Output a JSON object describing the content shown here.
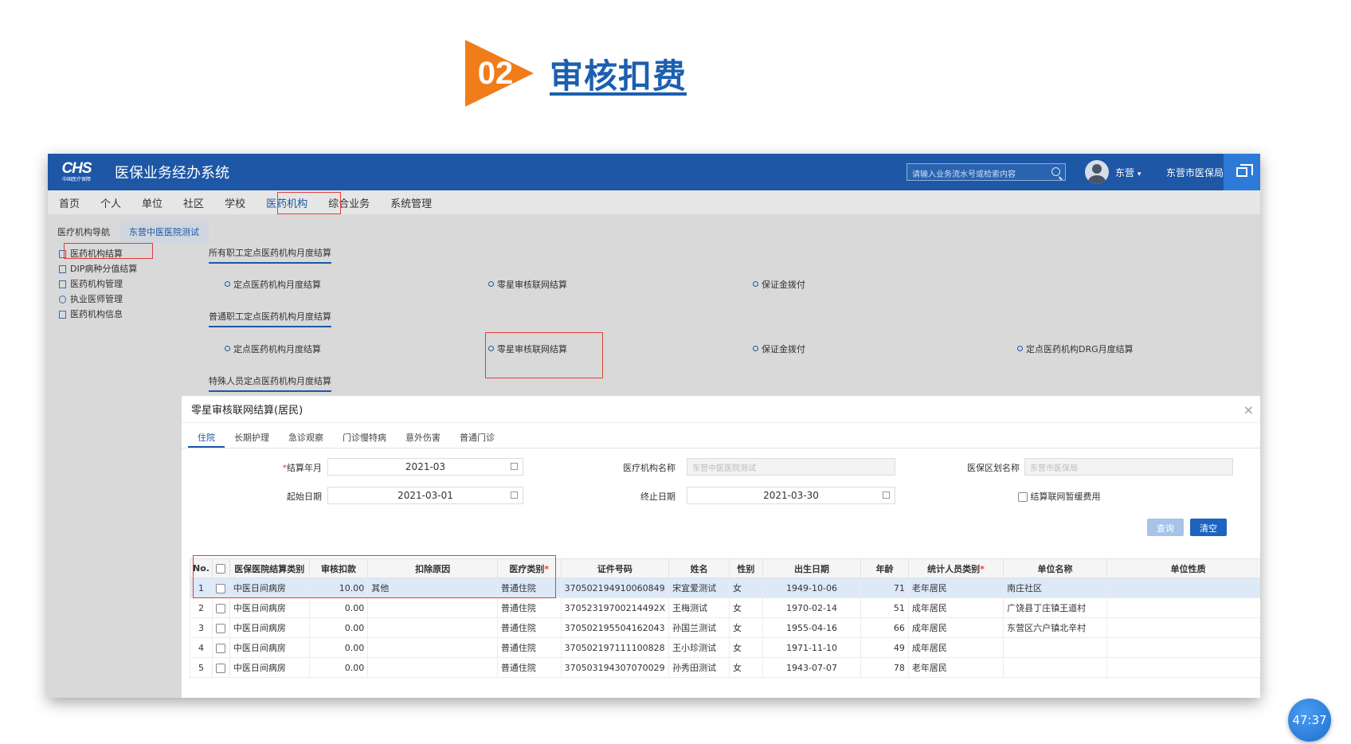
{
  "slide": {
    "badge_number": "02",
    "title": "审核扣费",
    "accent_color": "#f07d1a",
    "title_color": "#1c5fb0"
  },
  "app": {
    "logo_main": "CHS",
    "logo_sub": "中国医疗保障",
    "title": "医保业务经办系统",
    "search_placeholder": "请输入业务流水号或检索内容",
    "user_name": "东营",
    "user_caret": "▾",
    "org_name": "东营市医保局"
  },
  "nav": [
    "首页",
    "个人",
    "单位",
    "社区",
    "学校",
    "医药机构",
    "综合业务",
    "系统管理"
  ],
  "secondary_tabs": [
    "医疗机构导航",
    "东营中医医院测试"
  ],
  "tree": [
    "医药机构结算",
    "DIP病种分值结算",
    "医药机构管理",
    "执业医师管理",
    "医药机构信息"
  ],
  "sections": {
    "s1_title": "所有职工定点医药机构月度结算",
    "s1_links": [
      "定点医药机构月度结算",
      "零星审核联网结算",
      "保证金拨付"
    ],
    "s2_title": "普通职工定点医药机构月度结算",
    "s2_links": [
      "定点医药机构月度结算",
      "零星审核联网结算",
      "保证金拨付",
      "定点医药机构DRG月度结算"
    ],
    "s3_title": "特殊人员定点医药机构月度结算"
  },
  "dialog": {
    "title": "零星审核联网结算(居民)",
    "close": "×",
    "tabs": [
      "住院",
      "长期护理",
      "急诊观察",
      "门诊慢特病",
      "意外伤害",
      "普通门诊"
    ],
    "form": {
      "settle_month_label": "结算年月",
      "settle_month_required": "*",
      "settle_month": "2021-03",
      "start_date_label": "起始日期",
      "start_date": "2021-03-01",
      "org_name_label": "医疗机构名称",
      "org_name": "东营中医医院测试",
      "end_date_label": "终止日期",
      "end_date": "2021-03-30",
      "region_label": "医保区划名称",
      "region": "东营市医保局",
      "checkbox_label": "结算联网暂缓费用"
    },
    "buttons": {
      "query": "查询",
      "clear": "清空"
    },
    "table": {
      "headers": [
        "No.",
        "",
        "医保医院结算类别",
        "审核扣款",
        "扣除原因",
        "医疗类别",
        "证件号码",
        "姓名",
        "性别",
        "出生日期",
        "年龄",
        "统计人员类别",
        "单位名称",
        "单位性质"
      ],
      "required_mark": "*",
      "rows": [
        [
          "1",
          "",
          "中医日间病房",
          "10.00",
          "其他",
          "普通住院",
          "370502194910060849",
          "宋宜爱测试",
          "女",
          "1949-10-06",
          "71",
          "老年居民",
          "南庄社区",
          ""
        ],
        [
          "2",
          "",
          "中医日间病房",
          "0.00",
          "",
          "普通住院",
          "37052319700214492X",
          "王梅测试",
          "女",
          "1970-02-14",
          "51",
          "成年居民",
          "广饶县丁庄镇王道村",
          ""
        ],
        [
          "3",
          "",
          "中医日间病房",
          "0.00",
          "",
          "普通住院",
          "370502195504162043",
          "孙国兰测试",
          "女",
          "1955-04-16",
          "66",
          "成年居民",
          "东营区六户镇北辛村",
          ""
        ],
        [
          "4",
          "",
          "中医日间病房",
          "0.00",
          "",
          "普通住院",
          "370502197111100828",
          "王小珍测试",
          "女",
          "1971-11-10",
          "49",
          "成年居民",
          "",
          ""
        ],
        [
          "5",
          "",
          "中医日间病房",
          "0.00",
          "",
          "普通住院",
          "370503194307070029",
          "孙秀田测试",
          "女",
          "1943-07-07",
          "78",
          "老年居民",
          "",
          ""
        ]
      ]
    }
  },
  "timer": "47:37"
}
